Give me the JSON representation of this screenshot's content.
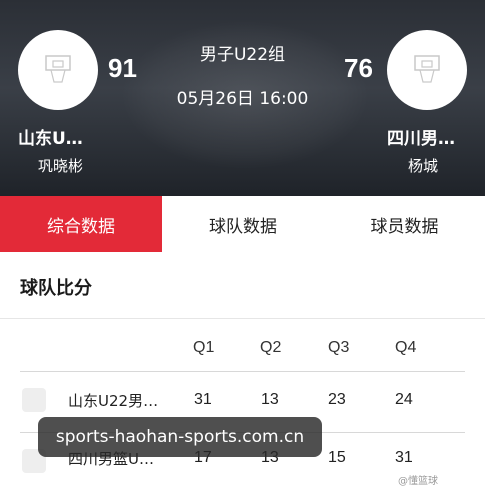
{
  "match": {
    "category": "男子U22组",
    "datetime": "05月26日 16:00",
    "home": {
      "name": "山东U…",
      "score": "91",
      "top_player": "巩晓彬"
    },
    "away": {
      "name": "四川男…",
      "score": "76",
      "top_player": "杨城"
    }
  },
  "tabs": [
    {
      "label": "综合数据",
      "active": true
    },
    {
      "label": "球队数据",
      "active": false
    },
    {
      "label": "球员数据",
      "active": false
    }
  ],
  "score_table": {
    "title": "球队比分",
    "headers": [
      "Q1",
      "Q2",
      "Q3",
      "Q4"
    ],
    "rows": [
      {
        "team": "山东U22男…",
        "q": [
          "31",
          "13",
          "23",
          "24"
        ]
      },
      {
        "team": "四川男篮U…",
        "q": [
          "17",
          "13",
          "15",
          "31"
        ]
      }
    ]
  },
  "overlay": {
    "watermark": "sports-haohan-sports.com.cn",
    "credit": "@懂篮球"
  },
  "colors": {
    "accent": "#e32a38",
    "header_bg": "#2b2f36"
  }
}
